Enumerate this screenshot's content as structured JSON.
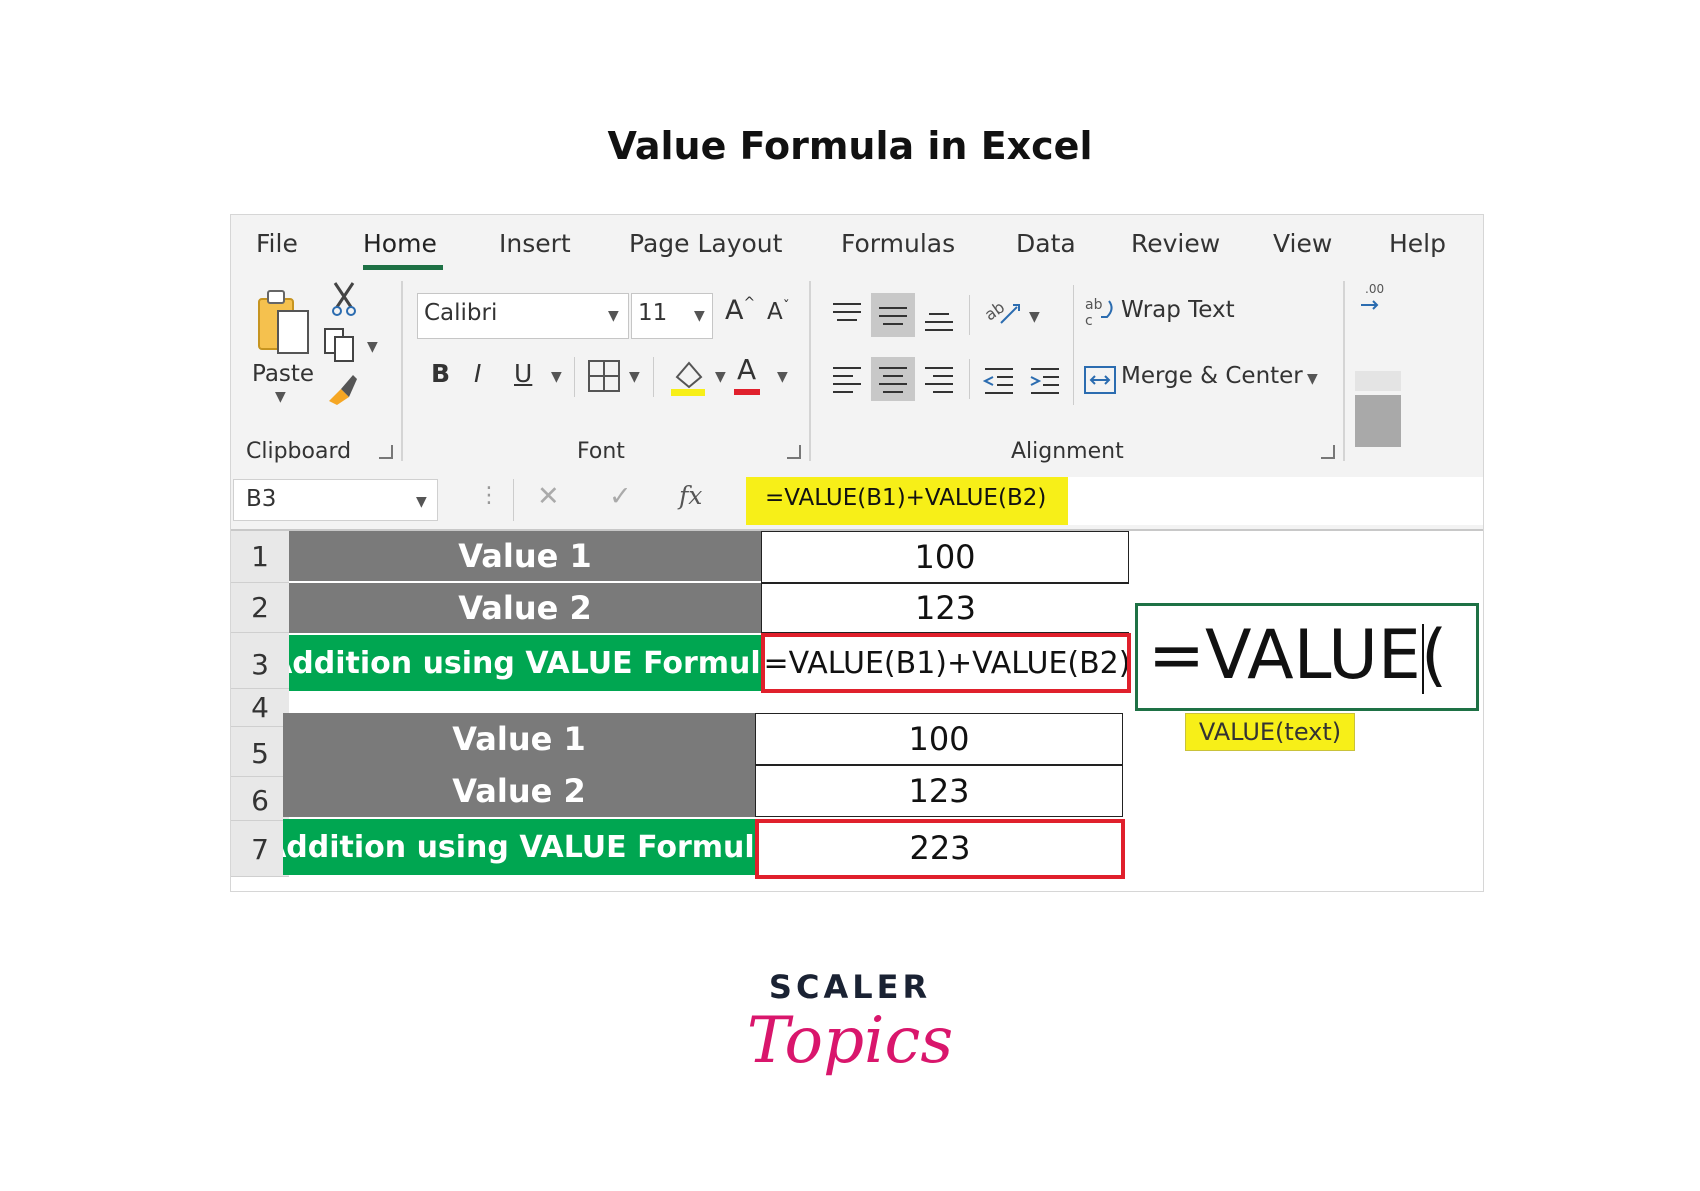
{
  "page_title": "Value Formula in Excel",
  "menu_tabs": [
    {
      "label": "File"
    },
    {
      "label": "Home"
    },
    {
      "label": "Insert"
    },
    {
      "label": "Page Layout"
    },
    {
      "label": "Formulas"
    },
    {
      "label": "Data"
    },
    {
      "label": "Review"
    },
    {
      "label": "View"
    },
    {
      "label": "Help"
    }
  ],
  "active_tab": "Home",
  "ribbon": {
    "clipboard": {
      "paste_label": "Paste",
      "group_label": "Clipboard"
    },
    "font": {
      "font_name": "Calibri",
      "font_size": "11",
      "bold": "B",
      "italic": "I",
      "underline": "U",
      "font_color_glyph": "A",
      "group_label": "Font"
    },
    "alignment": {
      "wrap_text": "Wrap Text",
      "merge_center": "Merge & Center",
      "group_label": "Alignment"
    }
  },
  "formula_bar": {
    "name_box": "B3",
    "fx": "fx",
    "formula": "=VALUE(B1)+VALUE(B2)"
  },
  "rows": [
    {
      "num": "1",
      "label": "Value 1",
      "value": "100"
    },
    {
      "num": "2",
      "label": "Value 2",
      "value": "123"
    },
    {
      "num": "3",
      "label": "Addition using VALUE Formula",
      "value": "=VALUE(B1)+VALUE(B2)"
    },
    {
      "num": "4"
    },
    {
      "num": "5",
      "label": "Value 1",
      "value": "100"
    },
    {
      "num": "6",
      "label": "Value 2",
      "value": "123"
    },
    {
      "num": "7",
      "label": "Addition using VALUE Formula",
      "value": "223"
    }
  ],
  "edit_popup": {
    "text": "=VALUE(",
    "tooltip": "VALUE(text)"
  },
  "colors": {
    "accent": "#1e7145",
    "label_grey": "#7a7a7a",
    "label_green": "#00a651",
    "highlight_red": "#e0202c",
    "highlight_yellow": "#f7ef18"
  },
  "logo": {
    "line1": "SCALER",
    "line2": "Topics"
  }
}
